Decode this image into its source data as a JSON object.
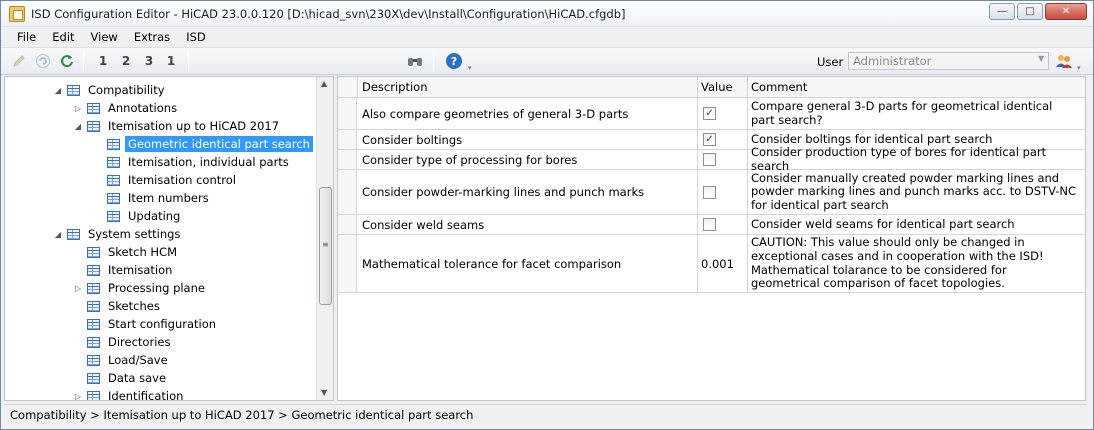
{
  "window": {
    "title": "ISD Configuration Editor  - HiCAD 23.0.0.120 [D:\\hicad_svn\\230X\\dev\\Install\\Configuration\\HiCAD.cfgdb]",
    "controls": {
      "minimize": "—",
      "maximize": "□",
      "close": "✕"
    }
  },
  "menu": [
    "File",
    "Edit",
    "View",
    "Extras",
    "ISD"
  ],
  "toolbar": {
    "user_label": "User",
    "user_value": "Administrator",
    "icons": [
      "edit-icon",
      "undo-icon",
      "refresh-icon",
      "numbering-1-icon",
      "numbering-2-icon",
      "numbering-3-icon",
      "numbering-4-icon",
      "find-icon",
      "help-icon",
      "users-icon"
    ],
    "numbering_glyphs": [
      "1",
      "2",
      "3",
      "1"
    ]
  },
  "tree": [
    {
      "label": "Compatibility",
      "expander": "◢"
    },
    {
      "label": "Annotations",
      "expander": "▷"
    },
    {
      "label": "Itemisation up to HiCAD 2017",
      "expander": "◢"
    },
    {
      "label": "Geometric identical part search",
      "expander": "",
      "selected": true
    },
    {
      "label": "Itemisation, individual parts",
      "expander": ""
    },
    {
      "label": "Itemisation control",
      "expander": ""
    },
    {
      "label": "Item numbers",
      "expander": ""
    },
    {
      "label": "Updating",
      "expander": ""
    },
    {
      "label": "System settings",
      "expander": "◢"
    },
    {
      "label": "Sketch HCM",
      "expander": ""
    },
    {
      "label": "Itemisation",
      "expander": ""
    },
    {
      "label": "Processing plane",
      "expander": "▷"
    },
    {
      "label": "Sketches",
      "expander": ""
    },
    {
      "label": "Start configuration",
      "expander": ""
    },
    {
      "label": "Directories",
      "expander": ""
    },
    {
      "label": "Load/Save",
      "expander": ""
    },
    {
      "label": "Data save",
      "expander": ""
    },
    {
      "label": "Identification",
      "expander": "▷"
    }
  ],
  "grid": {
    "columns": [
      "Description",
      "Value",
      "Comment"
    ],
    "rows": [
      {
        "description": "Also compare geometries of general 3-D parts",
        "value_type": "checkbox",
        "checked": true,
        "value": "",
        "comment": "Compare general 3-D parts for geometrical identical part search?"
      },
      {
        "description": "Consider boltings",
        "value_type": "checkbox",
        "checked": true,
        "value": "",
        "comment": "Consider boltings for identical part search"
      },
      {
        "description": "Consider type of processing for bores",
        "value_type": "checkbox",
        "checked": false,
        "value": "",
        "comment": "Consider production type of bores for identical part search"
      },
      {
        "description": "Consider powder-marking lines and punch marks",
        "value_type": "checkbox",
        "checked": false,
        "value": "",
        "comment": "Consider manually created powder marking lines and powder marking lines and punch marks acc. to DSTV-NC for identical part search"
      },
      {
        "description": "Consider weld seams",
        "value_type": "checkbox",
        "checked": false,
        "value": "",
        "comment": "Consider weld seams for identical part search"
      },
      {
        "description": "Mathematical tolerance for facet comparison",
        "value_type": "text",
        "checked": false,
        "value": "0.001",
        "comment": "CAUTION: This value should only be changed in exceptional cases and in cooperation with the ISD! Mathematical tolarance to be considered for geometrical comparison of facet topologies."
      }
    ]
  },
  "status": {
    "breadcrumb": "Compatibility > Itemisation up to HiCAD 2017 > Geometric identical part search"
  }
}
